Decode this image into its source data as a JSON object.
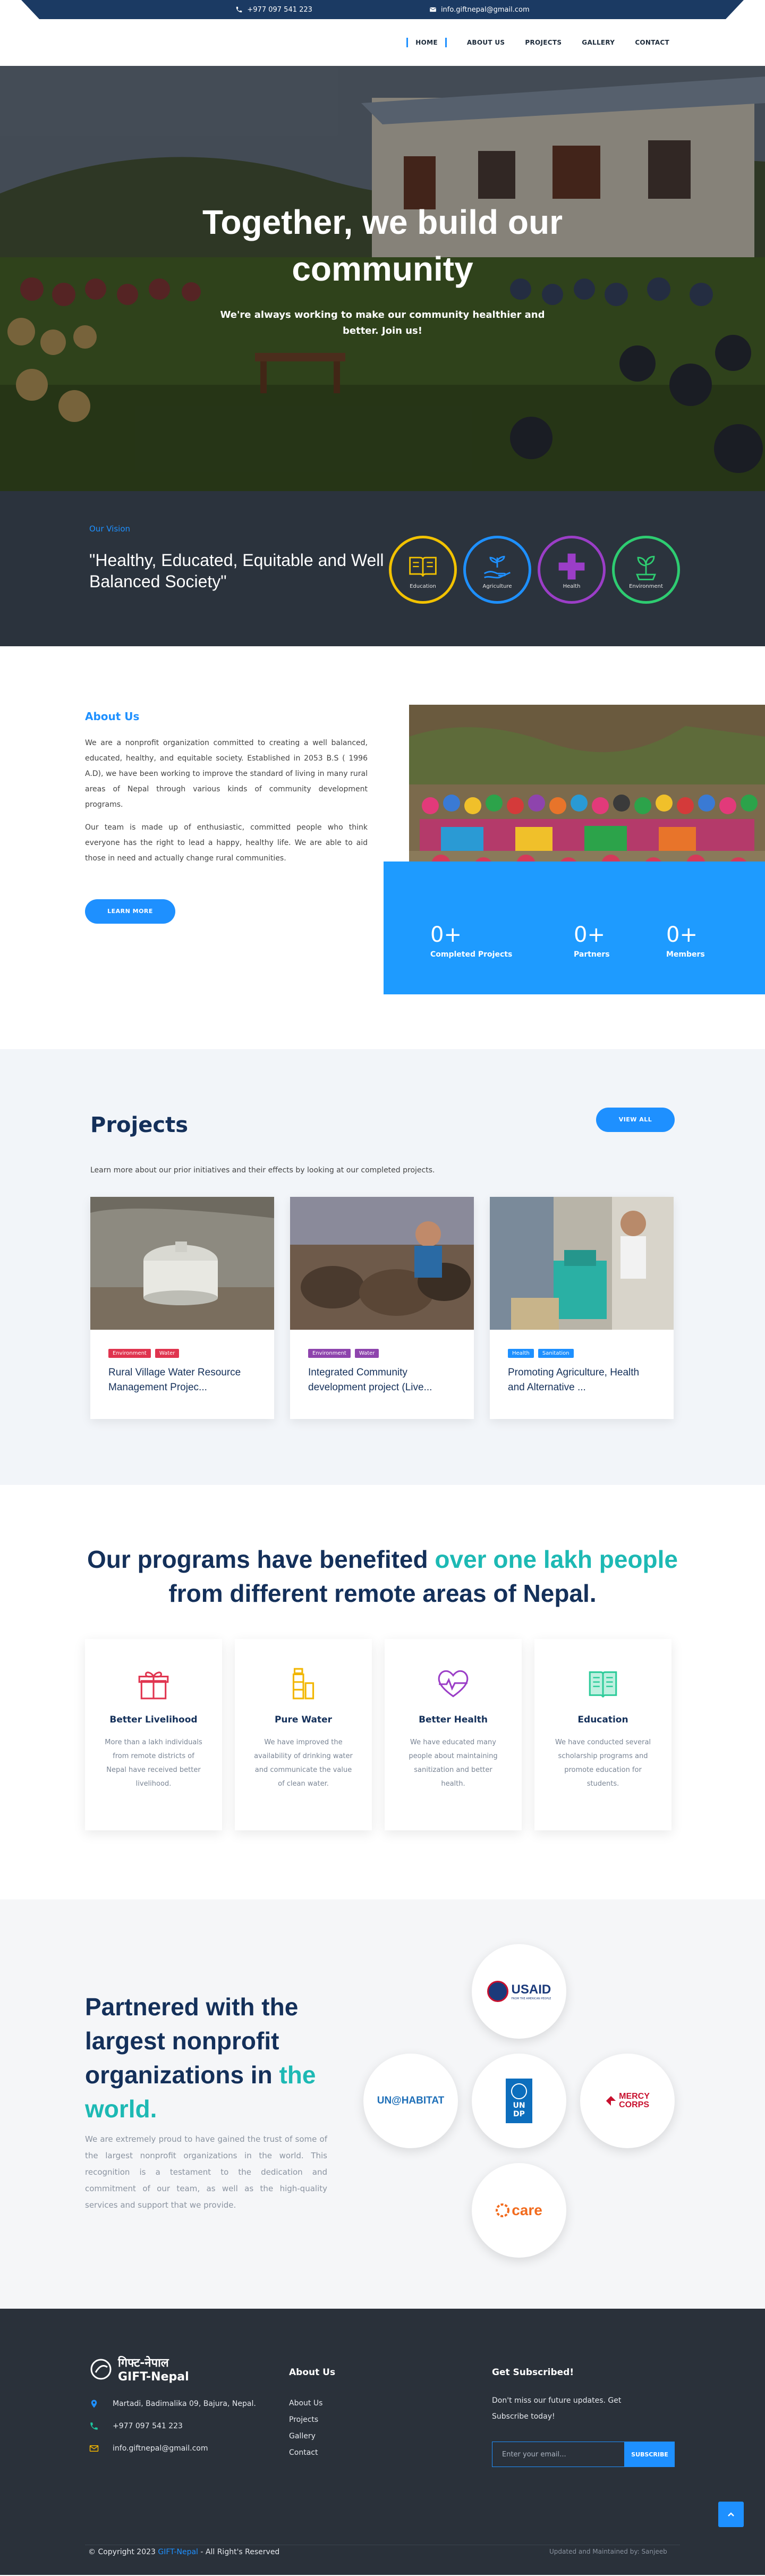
{
  "topbar": {
    "phone": "+977 097 541 223",
    "email": "info.giftnepal@gmail.com"
  },
  "nav": [
    "HOME",
    "ABOUT US",
    "PROJECTS",
    "GALLERY",
    "CONTACT"
  ],
  "hero": {
    "title": "Together, we build our community",
    "subtitle": "We're always working to make our community healthier and better. Join us!"
  },
  "vision": {
    "label": "Our Vision",
    "text": "\"Healthy, Educated, Equitable and Well Balanced Society\"",
    "icons": [
      {
        "label": "Education",
        "icon": "book-icon",
        "color": "#f2c200"
      },
      {
        "label": "Agriculture",
        "icon": "hand-plant-icon",
        "color": "#1e90ff"
      },
      {
        "label": "Health",
        "icon": "plus-icon",
        "color": "#9b3ec7"
      },
      {
        "label": "Environment",
        "icon": "sprout-icon",
        "color": "#2ecc71"
      }
    ]
  },
  "about": {
    "heading": "About Us",
    "paragraphs": [
      "We are a nonprofit organization committed to creating a well balanced, educated, healthy, and equitable society. Established in 2053 B.S ( 1996 A.D), we have been working to improve the standard of living in many rural areas of Nepal through various kinds of community development programs.",
      "Our team is made up of enthusiastic, committed people who think everyone has the right to lead a happy, healthy life. We are able to aid those in need and actually change rural communities."
    ],
    "button": "LEARN MORE",
    "stats": [
      {
        "value": "0+",
        "label": "Completed Projects"
      },
      {
        "value": "0+",
        "label": "Partners"
      },
      {
        "value": "0+",
        "label": "Members"
      }
    ]
  },
  "projects": {
    "title": "Projects",
    "view_all": "VIEW ALL",
    "lead": "Learn more about our prior initiatives and their effects by looking at our completed projects.",
    "cards": [
      {
        "tags": [
          {
            "label": "Environment",
            "color": "#e0344f"
          },
          {
            "label": "Water",
            "color": "#e0344f"
          }
        ],
        "title": "Rural Village Water Resource Management Projec..."
      },
      {
        "tags": [
          {
            "label": "Environment",
            "color": "#8e44ad"
          },
          {
            "label": "Water",
            "color": "#8e44ad"
          }
        ],
        "title": "Integrated Community development project (Live..."
      },
      {
        "tags": [
          {
            "label": "Health",
            "color": "#1e90ff"
          },
          {
            "label": "Sanitation",
            "color": "#1e90ff"
          }
        ],
        "title": "Promoting Agriculture, Health and Alternative ..."
      }
    ]
  },
  "programs": {
    "heading_a": "Our programs have benefited ",
    "heading_hl": "over one lakh people",
    "heading_b": " from different remote areas of Nepal.",
    "cards": [
      {
        "icon": "gift-box-icon",
        "color": "#e0344f",
        "title": "Better Livelihood",
        "desc": "More than a lakh individuals from remote districts of Nepal have received better livelihood."
      },
      {
        "icon": "water-bottle-icon",
        "color": "#f2b600",
        "title": "Pure Water",
        "desc": "We have improved the availability of drinking water and communicate the value of clean water."
      },
      {
        "icon": "heartbeat-icon",
        "color": "#9b3ec7",
        "title": "Better Health",
        "desc": "We have educated many people about maintaining sanitization and better health."
      },
      {
        "icon": "open-book-icon",
        "color": "#2ecc9a",
        "title": "Education",
        "desc": "We have conducted several scholarship programs and promote education for students."
      }
    ]
  },
  "partners": {
    "heading_a": "Partnered with the largest nonprofit organizations in ",
    "heading_hl": "the world.",
    "text": "We are extremely proud to have gained the trust of some of the largest nonprofit organizations in the world. This recognition is a testament to the dedication and commitment of our team, as well as the high-quality services and support that we provide.",
    "logos": {
      "usaid": "USAID",
      "usaid_sub": "FROM THE AMERICAN PEOPLE",
      "unhabitat": "UN@HABITAT",
      "undp": "UN DP",
      "mercy_a": "MERCY",
      "mercy_b": "CORPS",
      "care": "care"
    }
  },
  "footer": {
    "logo_top": "गिफ्ट-नेपाल",
    "logo_bottom": "GIFT-Nepal",
    "address": "Martadi, Badimalika 09, Bajura, Nepal.",
    "phone": "+977 097 541 223",
    "email": "info.giftnepal@gmail.com",
    "about_title": "About Us",
    "links": [
      "About Us",
      "Projects",
      "Gallery",
      "Contact"
    ],
    "subscribe_title": "Get Subscribed!",
    "subscribe_text": "Don't miss our future updates. Get Subscribe today!",
    "email_placeholder": "Enter your email...",
    "subscribe_button": "SUBSCRIBE",
    "copyright_a": "© Copyright 2023 ",
    "copyright_brand": "GIFT-Nepal",
    "copyright_b": " - All Right's Reserved",
    "credit": "Updated and Maintained by: Sanjeeb"
  }
}
